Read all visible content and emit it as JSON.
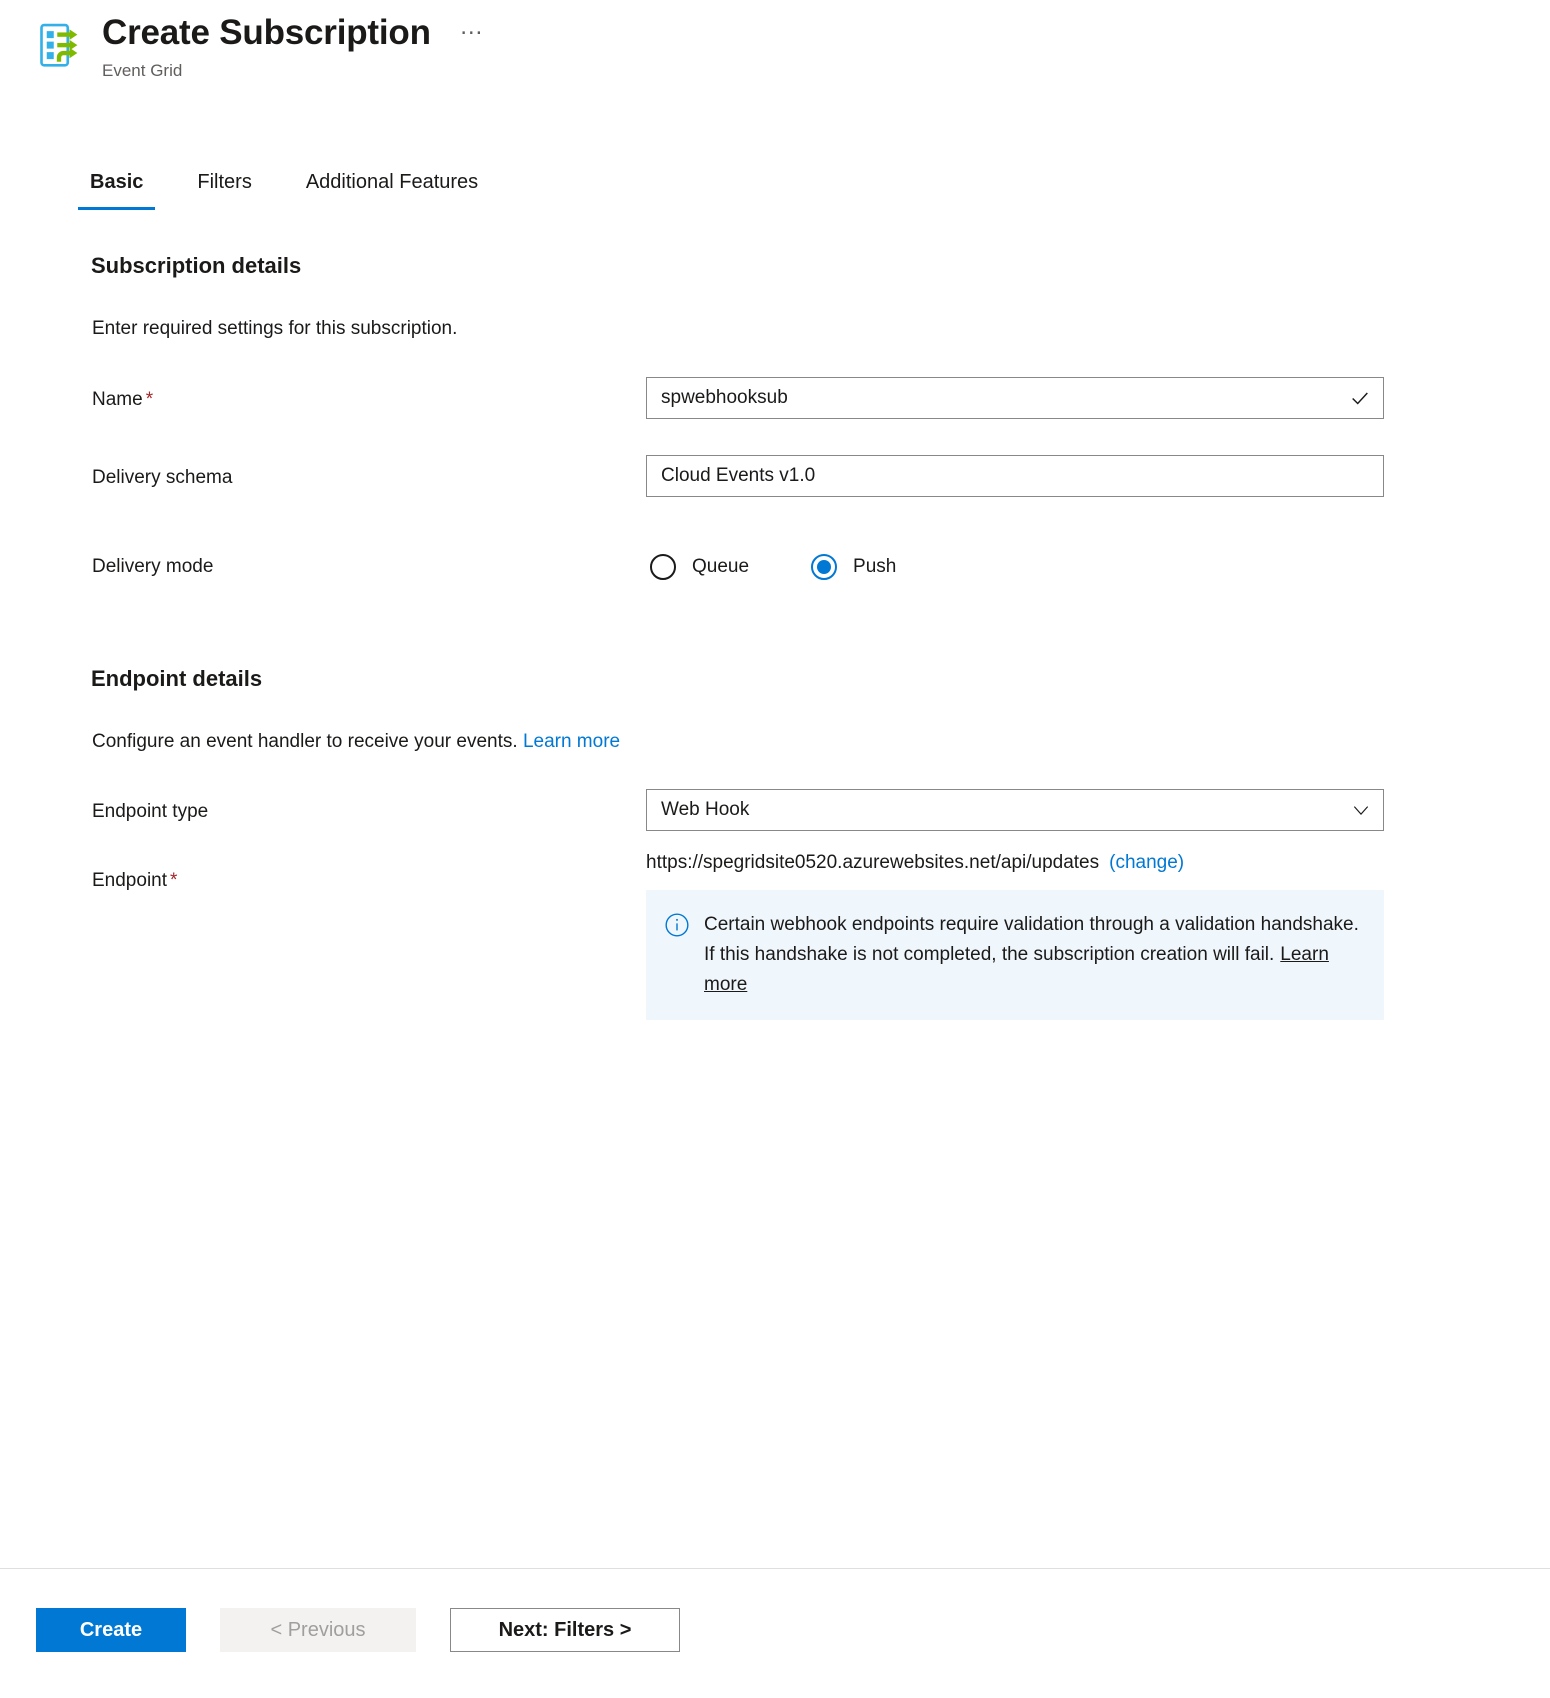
{
  "header": {
    "title": "Create Subscription",
    "subtitle": "Event Grid",
    "more_label": "…",
    "icon": "event-grid-icon"
  },
  "tabs": [
    {
      "label": "Basic",
      "active": true
    },
    {
      "label": "Filters",
      "active": false
    },
    {
      "label": "Additional Features",
      "active": false
    }
  ],
  "subscription_details": {
    "heading": "Subscription details",
    "description": "Enter required settings for this subscription.",
    "name": {
      "label": "Name",
      "required_marker": "*",
      "value": "spwebhooksub",
      "placeholder": "",
      "validation_icon": "checkmark-icon"
    },
    "delivery_schema": {
      "label": "Delivery schema",
      "value": "Cloud Events v1.0"
    },
    "delivery_mode": {
      "label": "Delivery mode",
      "options": [
        {
          "label": "Queue",
          "selected": false
        },
        {
          "label": "Push",
          "selected": true
        }
      ]
    }
  },
  "endpoint_details": {
    "heading": "Endpoint details",
    "description": "Configure an event handler to receive your events.",
    "description_link": "Learn more",
    "endpoint_type": {
      "label": "Endpoint type",
      "value": "Web Hook",
      "dropdown_icon": "chevron-down-icon"
    },
    "endpoint": {
      "label": "Endpoint",
      "required_marker": "*",
      "url": "https://spegridsite0520.azurewebsites.net/api/updates",
      "change_link": "(change)"
    },
    "info": {
      "icon": "info-circle-icon",
      "text": "Certain webhook endpoints require validation through a validation handshake. If this handshake is not completed, the subscription creation will fail.",
      "link": "Learn more"
    }
  },
  "footer": {
    "create_label": "Create",
    "previous_label": "< Previous",
    "next_label": "Next: Filters >"
  },
  "colors": {
    "accent": "#0078d4",
    "required": "#a4262c",
    "info_background": "#eff6fc",
    "disabled_background": "#f3f2f1",
    "border": "#8a8886"
  }
}
